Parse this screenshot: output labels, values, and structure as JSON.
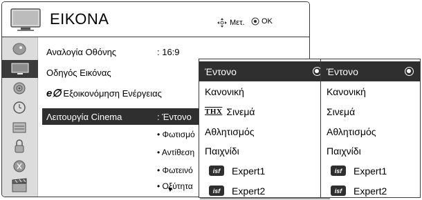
{
  "header": {
    "title": "ΕΙΚΟΝΑ",
    "move_hint": "Μετ.",
    "ok_hint": "OK"
  },
  "menu": {
    "rows": [
      {
        "label": "Αναλογία Οθόνης",
        "value": ": 16:9"
      },
      {
        "label": "Οδηγός Εικόνας",
        "value": ""
      },
      {
        "label": "Εξοικονόμηση Ενέργειας",
        "value": ""
      },
      {
        "label": "Λειτουργία Cinema",
        "value": ": Έντονο"
      }
    ],
    "eco_mark": "e∅",
    "sub_items": [
      "• Φωτισμό",
      "• Αντίθεση",
      "• Φωτεινό",
      "• Οξύτητα"
    ],
    "more_arrow": "▼"
  },
  "popup_primary": {
    "options": [
      "Έντονο",
      "Κανονική",
      "Σινεμά",
      "Αθλητισμός",
      "Παιχνίδι",
      "Expert1",
      "Expert2"
    ],
    "selected_index": 0,
    "thx_badge": "THX",
    "isf_badge": "isf"
  },
  "popup_secondary": {
    "options": [
      "Έντονο",
      "Κανονική",
      "Σινεμά",
      "Αθλητισμός",
      "Παιχνίδι",
      "Expert1",
      "Expert2"
    ],
    "selected_index": 0,
    "isf_badge": "isf"
  },
  "sidebar": {
    "icons": [
      "satellite-dish-icon",
      "picture-icon",
      "audio-icon",
      "clock-icon",
      "lock-options-icon",
      "lock-icon",
      "usb-icon",
      "cinema-clapper-icon"
    ],
    "active_index": 1
  },
  "colors": {
    "highlight": "#2f2f2f",
    "sidebar": "#dcdcdc",
    "border": "#3a3a3a"
  }
}
